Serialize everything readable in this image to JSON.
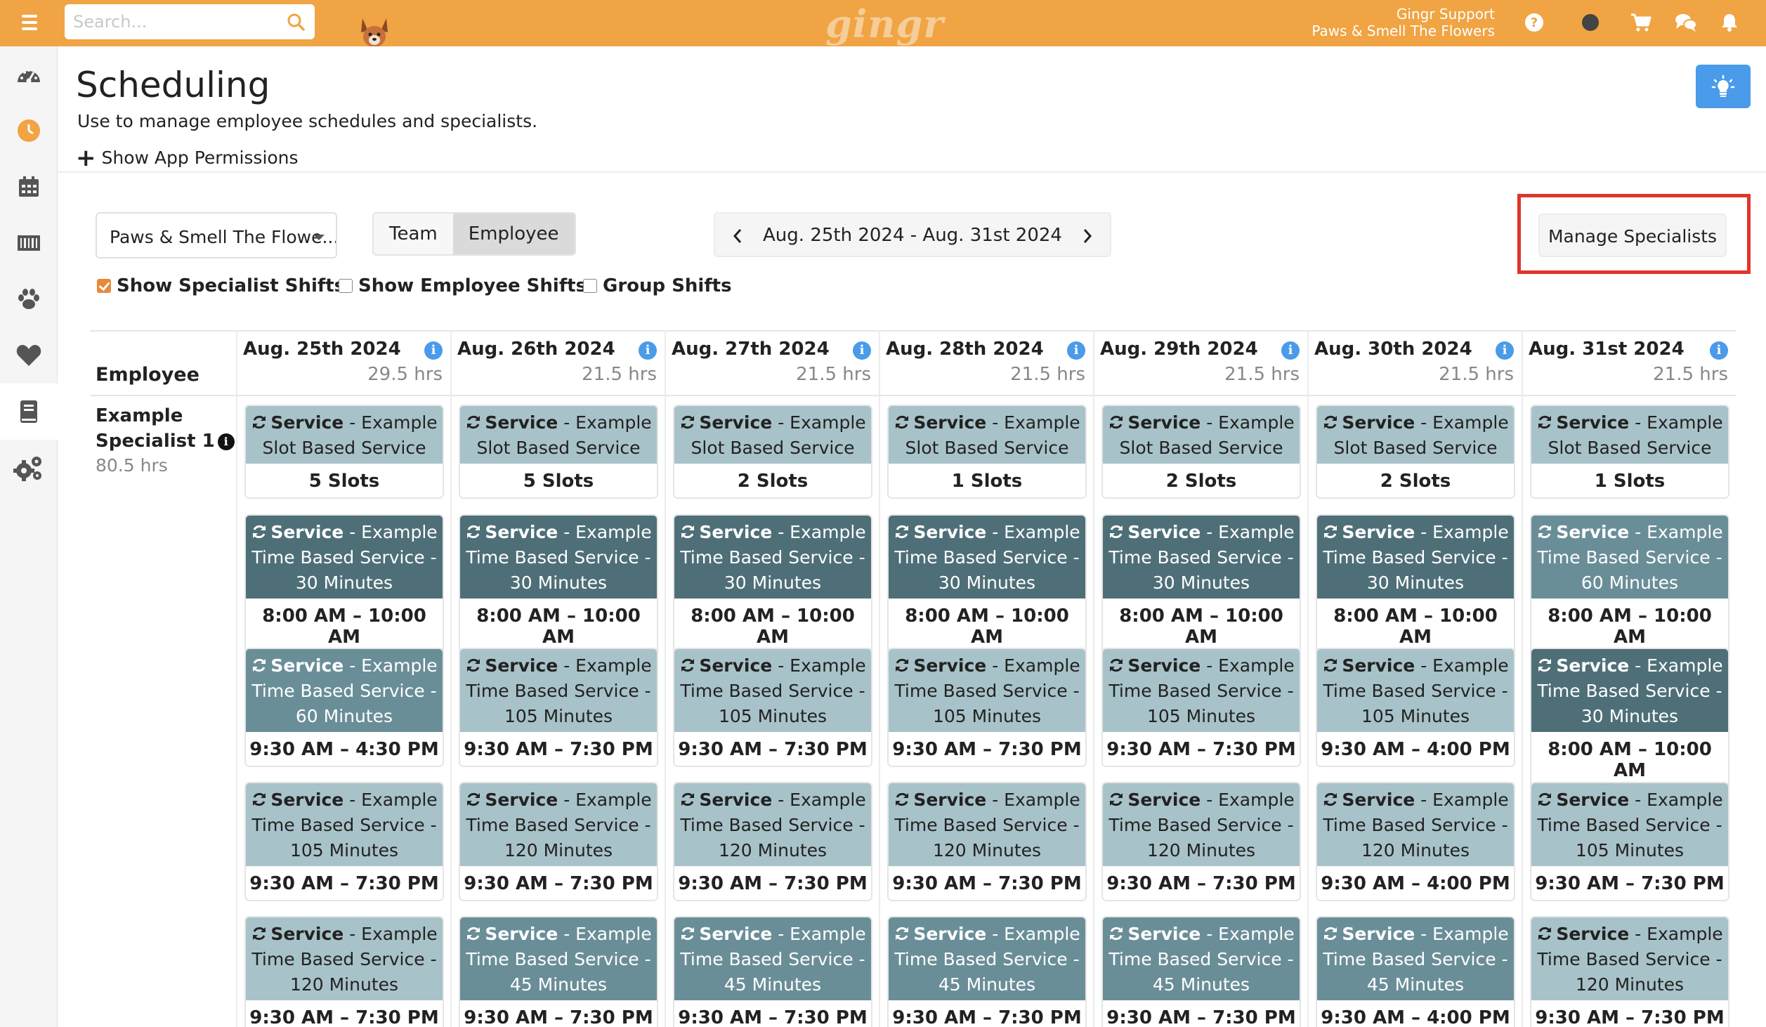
{
  "topbar": {
    "search_placeholder": "Search...",
    "logo": "gingr",
    "user_name": "Gingr Support",
    "user_location": "Paws & Smell The Flowers",
    "colors": {
      "bar": "#F0A443",
      "accent": "#4A9BE9"
    }
  },
  "sidebar": {
    "items": [
      "dashboard-icon",
      "clock-icon",
      "calendar-icon",
      "barcode-icon",
      "paw-icon",
      "heart-icon",
      "book-icon",
      "gears-icon"
    ]
  },
  "page": {
    "title": "Scheduling",
    "subtitle": "Use to manage employee schedules and specialists.",
    "permissions_link": "Show App Permissions"
  },
  "controls": {
    "location": "Paws & Smell The Flowe...",
    "view_team": "Team",
    "view_employee": "Employee",
    "date_range": "Aug. 25th 2024 - Aug. 31st 2024",
    "manage_specialists": "Manage Specialists",
    "show_specialist_shifts": {
      "label": "Show Specialist Shifts",
      "checked": true
    },
    "show_employee_shifts": {
      "label": "Show Employee Shifts",
      "checked": false
    },
    "group_shifts": {
      "label": "Group Shifts",
      "checked": false
    }
  },
  "grid": {
    "employee_header": "Employee",
    "days": [
      {
        "date": "Aug. 25th 2024",
        "hours": "29.5 hrs"
      },
      {
        "date": "Aug. 26th 2024",
        "hours": "21.5 hrs"
      },
      {
        "date": "Aug. 27th 2024",
        "hours": "21.5 hrs"
      },
      {
        "date": "Aug. 28th 2024",
        "hours": "21.5 hrs"
      },
      {
        "date": "Aug. 29th 2024",
        "hours": "21.5 hrs"
      },
      {
        "date": "Aug. 30th 2024",
        "hours": "21.5 hrs"
      },
      {
        "date": "Aug. 31st 2024",
        "hours": "21.5 hrs"
      }
    ],
    "specialist": {
      "name_line1": "Example",
      "name_line2": "Specialist 1",
      "hours": "80.5 hrs"
    },
    "service_word": "Service",
    "rows": [
      [
        {
          "desc": "- Example Slot Based Service",
          "slot": "5 Slots",
          "tone": "light"
        },
        {
          "desc": "- Example Slot Based Service",
          "slot": "5 Slots",
          "tone": "light"
        },
        {
          "desc": "- Example Slot Based Service",
          "slot": "2 Slots",
          "tone": "light"
        },
        {
          "desc": "- Example Slot Based Service",
          "slot": "1 Slots",
          "tone": "light"
        },
        {
          "desc": "- Example Slot Based Service",
          "slot": "2 Slots",
          "tone": "light"
        },
        {
          "desc": "- Example Slot Based Service",
          "slot": "2 Slots",
          "tone": "light"
        },
        {
          "desc": "- Example Slot Based Service",
          "slot": "1 Slots",
          "tone": "light"
        }
      ],
      [
        {
          "desc": "- Example Time Based Service - 30 Minutes",
          "slot": "8:00 AM – 10:00 AM",
          "tone": "dark"
        },
        {
          "desc": "- Example Time Based Service - 30 Minutes",
          "slot": "8:00 AM – 10:00 AM",
          "tone": "dark"
        },
        {
          "desc": "- Example Time Based Service - 30 Minutes",
          "slot": "8:00 AM – 10:00 AM",
          "tone": "dark"
        },
        {
          "desc": "- Example Time Based Service - 30 Minutes",
          "slot": "8:00 AM – 10:00 AM",
          "tone": "dark"
        },
        {
          "desc": "- Example Time Based Service - 30 Minutes",
          "slot": "8:00 AM – 10:00 AM",
          "tone": "dark"
        },
        {
          "desc": "- Example Time Based Service - 30 Minutes",
          "slot": "8:00 AM – 10:00 AM",
          "tone": "dark"
        },
        {
          "desc": "- Example Time Based Service - 60 Minutes",
          "slot": "8:00 AM – 10:00 AM",
          "tone": "mid"
        }
      ],
      [
        {
          "desc": "- Example Time Based Service - 60 Minutes",
          "slot": "9:30 AM – 4:30 PM",
          "tone": "mid"
        },
        {
          "desc": "- Example Time Based Service - 105 Minutes",
          "slot": "9:30 AM – 7:30 PM",
          "tone": "light"
        },
        {
          "desc": "- Example Time Based Service - 105 Minutes",
          "slot": "9:30 AM – 7:30 PM",
          "tone": "light"
        },
        {
          "desc": "- Example Time Based Service - 105 Minutes",
          "slot": "9:30 AM – 7:30 PM",
          "tone": "light"
        },
        {
          "desc": "- Example Time Based Service - 105 Minutes",
          "slot": "9:30 AM – 7:30 PM",
          "tone": "light"
        },
        {
          "desc": "- Example Time Based Service - 105 Minutes",
          "slot": "9:30 AM – 4:00 PM",
          "tone": "light"
        },
        {
          "desc": "- Example Time Based Service - 30 Minutes",
          "slot": "8:00 AM – 10:00 AM",
          "tone": "dark"
        }
      ],
      [
        {
          "desc": "- Example Time Based Service - 105 Minutes",
          "slot": "9:30 AM – 7:30 PM",
          "tone": "light"
        },
        {
          "desc": "- Example Time Based Service - 120 Minutes",
          "slot": "9:30 AM – 7:30 PM",
          "tone": "light"
        },
        {
          "desc": "- Example Time Based Service - 120 Minutes",
          "slot": "9:30 AM – 7:30 PM",
          "tone": "light"
        },
        {
          "desc": "- Example Time Based Service - 120 Minutes",
          "slot": "9:30 AM – 7:30 PM",
          "tone": "light"
        },
        {
          "desc": "- Example Time Based Service - 120 Minutes",
          "slot": "9:30 AM – 7:30 PM",
          "tone": "light"
        },
        {
          "desc": "- Example Time Based Service - 120 Minutes",
          "slot": "9:30 AM – 4:00 PM",
          "tone": "light"
        },
        {
          "desc": "- Example Time Based Service - 105 Minutes",
          "slot": "9:30 AM – 7:30 PM",
          "tone": "light"
        }
      ],
      [
        {
          "desc": "- Example Time Based Service - 120 Minutes",
          "slot": "9:30 AM – 7:30 PM",
          "tone": "light"
        },
        {
          "desc": "- Example Time Based Service - 45 Minutes",
          "slot": "9:30 AM – 7:30 PM",
          "tone": "mid"
        },
        {
          "desc": "- Example Time Based Service - 45 Minutes",
          "slot": "9:30 AM – 7:30 PM",
          "tone": "mid"
        },
        {
          "desc": "- Example Time Based Service - 45 Minutes",
          "slot": "9:30 AM – 7:30 PM",
          "tone": "mid"
        },
        {
          "desc": "- Example Time Based Service - 45 Minutes",
          "slot": "9:30 AM – 7:30 PM",
          "tone": "mid"
        },
        {
          "desc": "- Example Time Based Service - 45 Minutes",
          "slot": "9:30 AM – 4:00 PM",
          "tone": "mid"
        },
        {
          "desc": "- Example Time Based Service - 120 Minutes",
          "slot": "9:30 AM – 7:30 PM",
          "tone": "light"
        }
      ]
    ]
  }
}
